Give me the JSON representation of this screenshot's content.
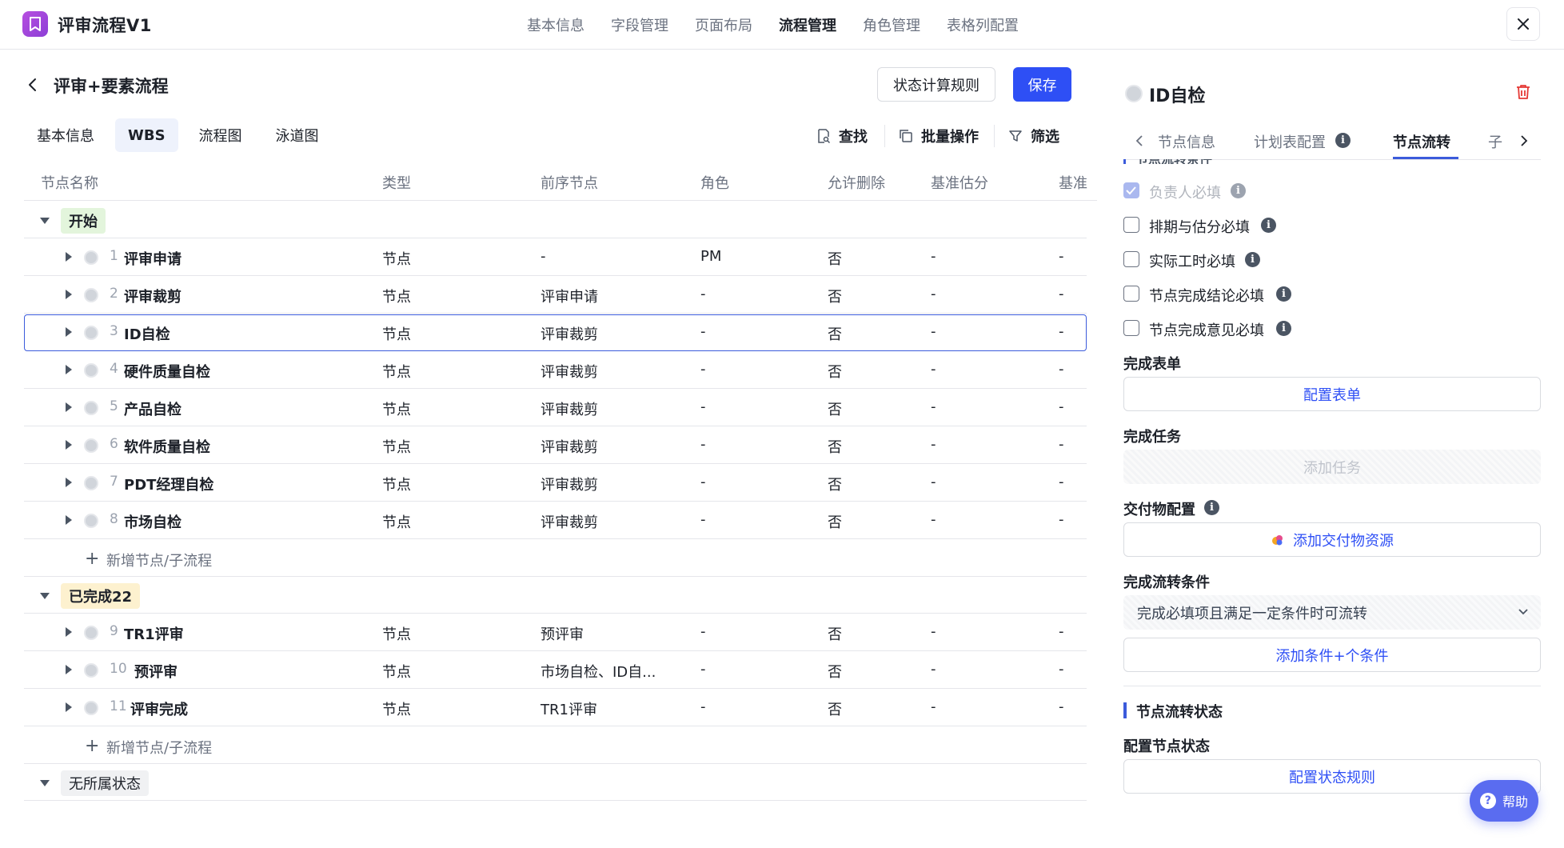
{
  "app": {
    "title": "评审流程V1"
  },
  "topnav": [
    "基本信息",
    "字段管理",
    "页面布局",
    "流程管理",
    "角色管理",
    "表格列配置"
  ],
  "page": {
    "title": "评审+要素流程",
    "status_rule_button": "状态计算规则",
    "save_button": "保存"
  },
  "subtabs": [
    "基本信息",
    "WBS",
    "流程图",
    "泳道图"
  ],
  "toolbar": {
    "find": "查找",
    "batch": "批量操作",
    "filter": "筛选"
  },
  "table": {
    "headers": [
      "节点名称",
      "类型",
      "前序节点",
      "角色",
      "允许删除",
      "基准估分",
      "基准"
    ],
    "groups": [
      {
        "label": "开始"
      },
      {
        "label": "已完成22"
      },
      {
        "label": "无所属状态"
      }
    ],
    "rows": [
      {
        "index": "1",
        "name": "评审申请",
        "type": "节点",
        "prev": "-",
        "role": "PM",
        "deletable": "否",
        "estimate": "-",
        "base": "-"
      },
      {
        "index": "2",
        "name": "评审裁剪",
        "type": "节点",
        "prev": "评审申请",
        "role": "-",
        "deletable": "否",
        "estimate": "-",
        "base": "-"
      },
      {
        "index": "3",
        "name": "ID自检",
        "type": "节点",
        "prev": "评审裁剪",
        "role": "-",
        "deletable": "否",
        "estimate": "-",
        "base": "-"
      },
      {
        "index": "4",
        "name": "硬件质量自检",
        "type": "节点",
        "prev": "评审裁剪",
        "role": "-",
        "deletable": "否",
        "estimate": "-",
        "base": "-"
      },
      {
        "index": "5",
        "name": "产品自检",
        "type": "节点",
        "prev": "评审裁剪",
        "role": "-",
        "deletable": "否",
        "estimate": "-",
        "base": "-"
      },
      {
        "index": "6",
        "name": "软件质量自检",
        "type": "节点",
        "prev": "评审裁剪",
        "role": "-",
        "deletable": "否",
        "estimate": "-",
        "base": "-"
      },
      {
        "index": "7",
        "name": "PDT经理自检",
        "type": "节点",
        "prev": "评审裁剪",
        "role": "-",
        "deletable": "否",
        "estimate": "-",
        "base": "-"
      },
      {
        "index": "8",
        "name": "市场自检",
        "type": "节点",
        "prev": "评审裁剪",
        "role": "-",
        "deletable": "否",
        "estimate": "-",
        "base": "-"
      },
      {
        "index": "9",
        "name": "TR1评审",
        "type": "节点",
        "prev": "预评审",
        "role": "-",
        "deletable": "否",
        "estimate": "-",
        "base": "-"
      },
      {
        "index": "10",
        "name": "预评审",
        "type": "节点",
        "prev": "市场自检、ID自...",
        "role": "-",
        "deletable": "否",
        "estimate": "-",
        "base": "-"
      },
      {
        "index": "11",
        "name": "评审完成",
        "type": "节点",
        "prev": "TR1评审",
        "role": "-",
        "deletable": "否",
        "estimate": "-",
        "base": "-"
      }
    ],
    "add_label": "新增节点/子流程"
  },
  "panel": {
    "title": "ID自检",
    "tabs": [
      "节点信息",
      "计划表配置",
      "节点流转",
      "子"
    ],
    "clipped_heading": "节点流转条件",
    "checkboxes": [
      {
        "label": "负责人必填",
        "checked": true
      },
      {
        "label": "排期与估分必填",
        "checked": false
      },
      {
        "label": "实际工时必填",
        "checked": false
      },
      {
        "label": "节点完成结论必填",
        "checked": false
      },
      {
        "label": "节点完成意见必填",
        "checked": false
      }
    ],
    "complete_form_label": "完成表单",
    "config_form_button": "配置表单",
    "complete_task_label": "完成任务",
    "add_task_button": "添加任务",
    "deliverable_label": "交付物配置",
    "add_deliverable_button": "添加交付物资源",
    "transition_label": "完成流转条件",
    "transition_select": "完成必填项且满足一定条件时可流转",
    "add_condition_button": "添加条件+个条件",
    "status_section": "节点流转状态",
    "config_status_label": "配置节点状态",
    "config_status_button": "配置状态规则"
  },
  "help": {
    "label": "帮助"
  },
  "colors": {
    "primary": "#2e4ff5",
    "start_tag": "#e3f5dc",
    "done_tag": "#fdf1cf",
    "none_tag": "#f0f1f3"
  }
}
